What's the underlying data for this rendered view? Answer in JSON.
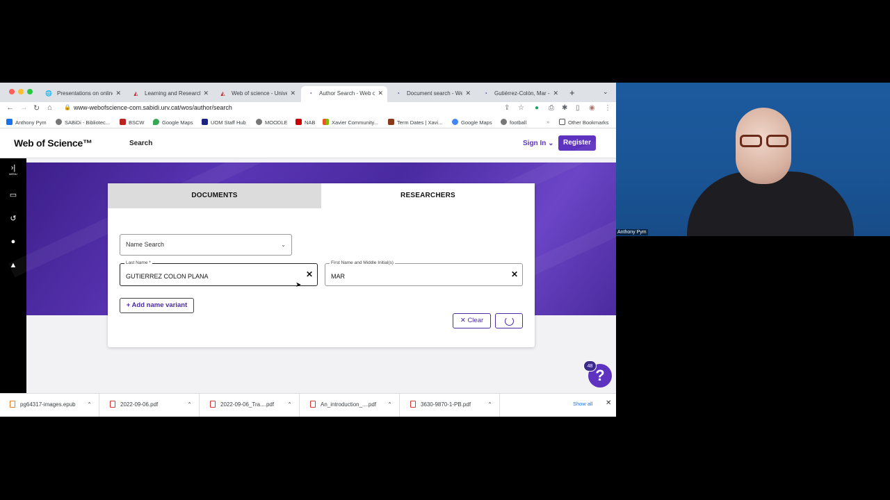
{
  "browser": {
    "tabs": [
      {
        "title": "Presentations on online",
        "icon": "globe-icon",
        "active": false
      },
      {
        "title": "Learning and Research R",
        "icon": "urv-icon",
        "active": false
      },
      {
        "title": "Web of science - Univers",
        "icon": "urv-icon",
        "active": false
      },
      {
        "title": "Author Search - Web of",
        "icon": "clarivate-icon",
        "active": true
      },
      {
        "title": "Document search - Web",
        "icon": "clarivate-icon",
        "active": false
      },
      {
        "title": "Gutiérrez-Colón, Mar - W",
        "icon": "clarivate-icon",
        "active": false
      }
    ],
    "url": "www-webofscience-com.sabidi.urv.cat/wos/author/search",
    "bookmarks": [
      "Anthony Pym",
      "SABiDi - Bibliotec...",
      "BSCW",
      "Google Maps",
      "UOM Staff Hub",
      "MOODLE",
      "NAB",
      "Xavier Community...",
      "Term Dates | Xavi...",
      "Google Maps",
      "football"
    ],
    "other_bookmarks": "Other Bookmarks"
  },
  "wos": {
    "logo": "Web of Science™",
    "nav_search": "Search",
    "sign_in": "Sign In ⌄",
    "register": "Register",
    "sidebar_menu_label": "MENU",
    "tabs": {
      "documents": "DOCUMENTS",
      "researchers": "RESEARCHERS"
    },
    "search_type": "Name Search",
    "last_name": {
      "label": "Last Name *",
      "value": "GUTIERREZ COLON PLANA"
    },
    "first_name": {
      "label": "First Name and Middle Initial(s)",
      "value": "MAR"
    },
    "add_variant": "+ Add name variant",
    "clear": "✕ Clear",
    "help_badge": "48",
    "help_glyph": "?"
  },
  "downloads": {
    "files": [
      "pg64317-images.epub",
      "2022-09-06.pdf",
      "2022-09-06_Tra....pdf",
      "An_introduction_....pdf",
      "3630-9870-1-PB.pdf"
    ],
    "show_all": "Show all"
  },
  "webcam": {
    "name": "Anthony Pym"
  }
}
